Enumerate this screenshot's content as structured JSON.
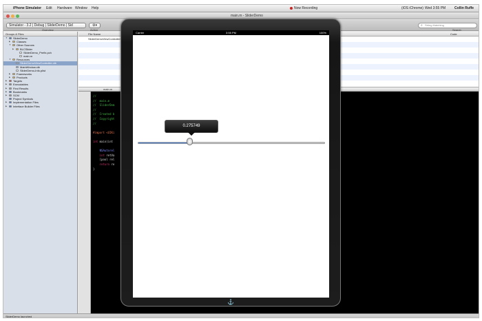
{
  "menubar": {
    "app_name": "iPhone Simulator",
    "items": [
      "Edit",
      "Hardware",
      "Window",
      "Help"
    ],
    "recording": "Now Recording",
    "clock": "Wed 3:55 PM",
    "user": "Collin Ruffe",
    "extra": "(iOS iChrome)"
  },
  "window": {
    "title": "main.m - SliderDemo"
  },
  "toolbar": {
    "scheme_popup": "Simulator - 3.2 | Debug | SliderDemo | Sid",
    "overview_label": "Overview",
    "action_label": "Action",
    "search_placeholder": "String Matching",
    "search_label": "Search"
  },
  "sidebar": {
    "header": "Groups & Files",
    "items": [
      {
        "label": "SliderDemo",
        "indent": 0,
        "color": "#4a78c9",
        "open": true
      },
      {
        "label": "Classes",
        "indent": 1,
        "color": "#e0b74a",
        "open": false
      },
      {
        "label": "Other Sources",
        "indent": 1,
        "color": "#e0b74a",
        "open": true
      },
      {
        "label": "BLCSlider",
        "indent": 2,
        "color": "#e0b74a",
        "open": false
      },
      {
        "label": "SliderDemo_Prefix.pch",
        "indent": 3,
        "color": "#ffffff",
        "open": null
      },
      {
        "label": "main.m",
        "indent": 3,
        "color": "#ffffff",
        "open": null
      },
      {
        "label": "Resources",
        "indent": 1,
        "color": "#e0b74a",
        "open": true
      },
      {
        "label": "SliderDemoViewController.xib",
        "indent": 2,
        "color": "#9bb7e0",
        "open": null,
        "selected": true
      },
      {
        "label": "MainWindow.xib",
        "indent": 2,
        "color": "#9bb7e0",
        "open": null
      },
      {
        "label": "SliderDemo-Info.plist",
        "indent": 2,
        "color": "#ffffff",
        "open": null
      },
      {
        "label": "Frameworks",
        "indent": 1,
        "color": "#e0b74a",
        "open": false
      },
      {
        "label": "Products",
        "indent": 1,
        "color": "#e0b74a",
        "open": false
      },
      {
        "label": "Targets",
        "indent": 0,
        "color": "#c65050",
        "open": false
      },
      {
        "label": "Executables",
        "indent": 0,
        "color": "#888888",
        "open": false
      },
      {
        "label": "Find Results",
        "indent": 0,
        "color": "#999999",
        "open": false
      },
      {
        "label": "Bookmarks",
        "indent": 0,
        "color": "#4a78c9",
        "open": false
      },
      {
        "label": "SCM",
        "indent": 0,
        "color": "#999999",
        "open": false
      },
      {
        "label": "Project Symbols",
        "indent": 0,
        "color": "#4a78c9",
        "open": null
      },
      {
        "label": "Implementation Files",
        "indent": 0,
        "color": "#4a78c9",
        "open": false
      },
      {
        "label": "Interface Builder Files",
        "indent": 0,
        "color": "#4a78c9",
        "open": false
      }
    ]
  },
  "detail": {
    "header_name": "File Name",
    "header_code": "Code",
    "rows": [
      "SliderDemoViewController.xib",
      "",
      "",
      "",
      "",
      "",
      "",
      "",
      ""
    ]
  },
  "editor": {
    "breadcrumb": "main.m",
    "lines": [
      [
        {
          "t": "//",
          "c": "com"
        }
      ],
      [
        {
          "t": "//  main.m",
          "c": "com"
        }
      ],
      [
        {
          "t": "//  SliderDem",
          "c": "com"
        }
      ],
      [
        {
          "t": "//",
          "c": "com"
        }
      ],
      [
        {
          "t": "//  Created b",
          "c": "com"
        }
      ],
      [
        {
          "t": "//  Copyright",
          "c": "com"
        }
      ],
      [
        {
          "t": "//",
          "c": "com"
        }
      ],
      [
        {
          "t": "",
          "c": "txt"
        }
      ],
      [
        {
          "t": "#import <UIKi",
          "c": "pre"
        }
      ],
      [
        {
          "t": "",
          "c": "txt"
        }
      ],
      [
        {
          "t": "int ",
          "c": "kw"
        },
        {
          "t": "main(int",
          "c": "txt"
        }
      ],
      [
        {
          "t": "",
          "c": "txt"
        }
      ],
      [
        {
          "t": "    NSAutorel",
          "c": "cls"
        }
      ],
      [
        {
          "t": "    int ",
          "c": "kw"
        },
        {
          "t": "retVa",
          "c": "txt"
        }
      ],
      [
        {
          "t": "    [pool rel",
          "c": "txt"
        }
      ],
      [
        {
          "t": "    return ",
          "c": "kw"
        },
        {
          "t": "re",
          "c": "txt"
        }
      ],
      [
        {
          "t": "}",
          "c": "txt"
        }
      ]
    ]
  },
  "status": {
    "text": "SliderDemo launched"
  },
  "ipad": {
    "carrier": "Carrier",
    "time": "3:55 PM",
    "battery": "100%",
    "slider_value": 0.275749,
    "slider_value_text": "0.275749"
  }
}
